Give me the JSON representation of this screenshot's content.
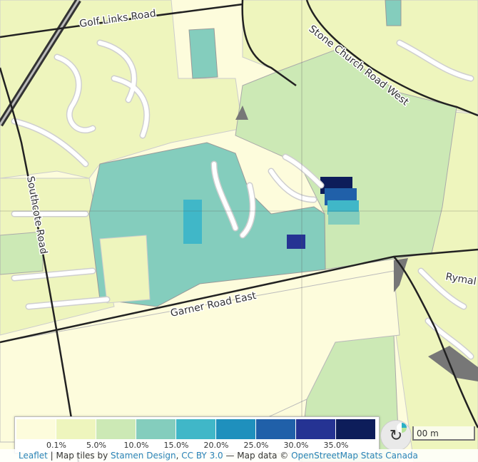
{
  "map": {
    "roads": {
      "golf_links": "Golf Links Road",
      "stone_church": "Stone Church Road West",
      "southcote": "Southcote Road",
      "garner": "Garner Road East",
      "rymal": "Rymal"
    }
  },
  "legend": {
    "colors": [
      "#fdfcdc",
      "#eef5bd",
      "#cce9b5",
      "#84cdbd",
      "#40b7c8",
      "#1f90bd",
      "#2060a9",
      "#253393",
      "#0d1d5a"
    ],
    "labels": [
      "0.1%",
      "5.0%",
      "10.0%",
      "15.0%",
      "20.0%",
      "25.0%",
      "30.0%",
      "35.0%"
    ]
  },
  "scale": {
    "label": "00 m"
  },
  "attribution": {
    "leaflet": "Leaflet",
    "sep1": " | Map tiles by ",
    "stamen": "Stamen Design",
    "sep2": ", ",
    "license": "CC BY 3.0",
    "sep3": " — Map data © ",
    "osm": "OpenStreetMap",
    "sep4": " ",
    "stats": "Stats Canada"
  }
}
